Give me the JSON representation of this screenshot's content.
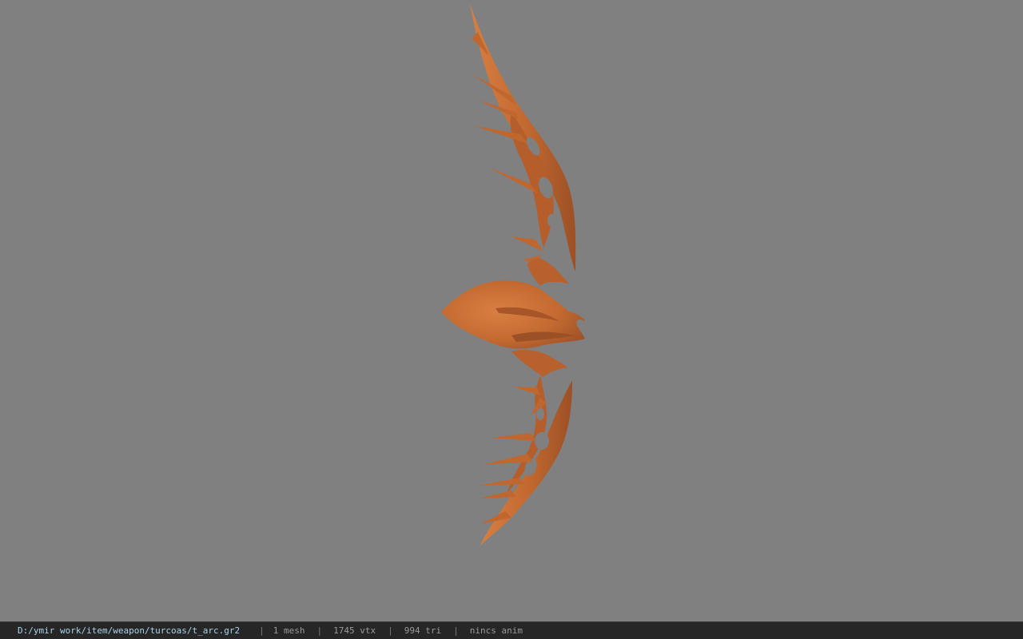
{
  "viewport": {
    "background": "#808080",
    "model_color": "#c0682f",
    "model_shade": "#a9572a",
    "model_light": "#d27a3e"
  },
  "status_bar": {
    "file_path": "D:/ymir work/item/weapon/turcoas/t_arc.gr2",
    "separator": "|",
    "mesh_count": "1 mesh",
    "vertex_count": "1745 vtx",
    "triangle_count": "994 tri",
    "animation": "nincs anim"
  }
}
